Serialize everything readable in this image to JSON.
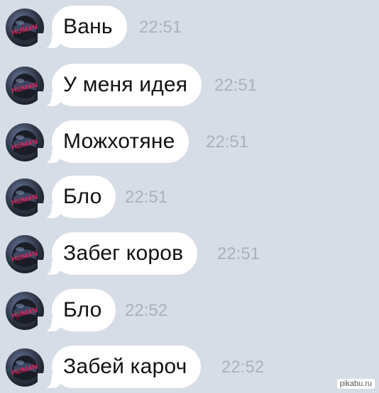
{
  "messages": [
    {
      "text": "Вань",
      "time": "22:51"
    },
    {
      "text": "У меня идея",
      "time": "22:51"
    },
    {
      "text": "Можхотяне",
      "time": "22:51"
    },
    {
      "text": "Бло",
      "time": "22:51"
    },
    {
      "text": "Забег коров",
      "time": "22:51"
    },
    {
      "text": "Бло",
      "time": "22:52"
    },
    {
      "text": "Забей кароч",
      "time": "22:52"
    }
  ],
  "avatar_label": "HUMAN",
  "watermark": "pikabu.ru",
  "colors": {
    "background": "#d7dde6",
    "bubble": "#ffffff",
    "time": "#a9b1be",
    "avatar_text": "#e0245e"
  }
}
